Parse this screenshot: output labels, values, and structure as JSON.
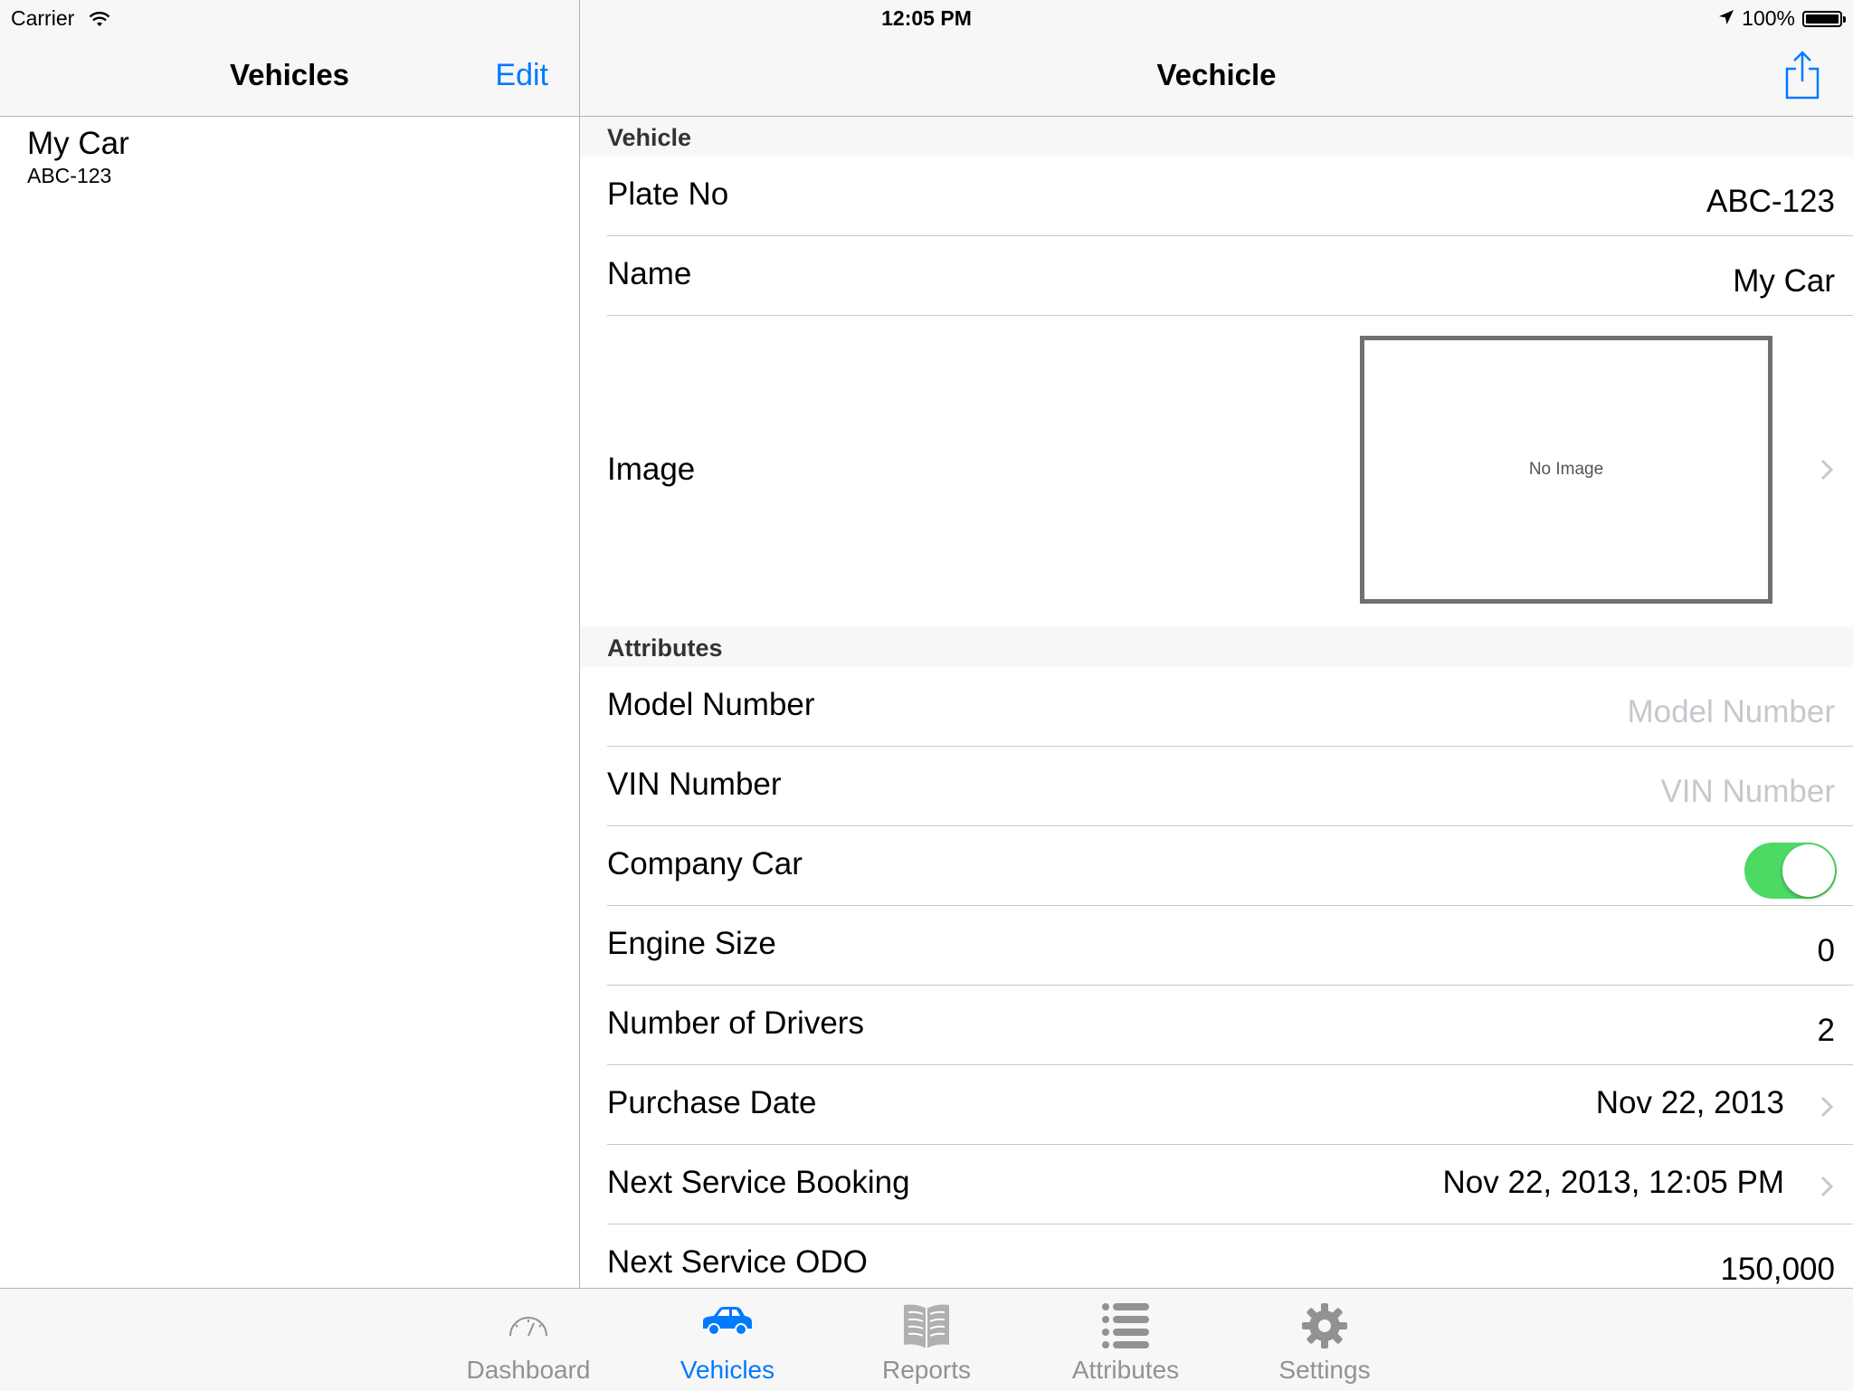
{
  "status_bar": {
    "carrier": "Carrier",
    "time": "12:05 PM",
    "battery": "100%"
  },
  "master": {
    "nav_title": "Vehicles",
    "edit_label": "Edit",
    "vehicles": [
      {
        "name": "My Car",
        "plate": "ABC-123"
      }
    ]
  },
  "detail": {
    "nav_title": "Vechicle",
    "sections": {
      "vehicle": {
        "header": "Vehicle",
        "plate": {
          "label": "Plate No",
          "value": "ABC-123"
        },
        "name": {
          "label": "Name",
          "value": "My Car"
        },
        "image": {
          "label": "Image",
          "placeholder": "No Image"
        }
      },
      "attributes": {
        "header": "Attributes",
        "model_number": {
          "label": "Model Number",
          "placeholder": "Model Number"
        },
        "vin_number": {
          "label": "VIN Number",
          "placeholder": "VIN Number"
        },
        "company_car": {
          "label": "Company Car",
          "on": true
        },
        "engine_size": {
          "label": "Engine Size",
          "value": "0"
        },
        "drivers": {
          "label": "Number of Drivers",
          "value": "2"
        },
        "purchase_date": {
          "label": "Purchase Date",
          "value": "Nov 22, 2013"
        },
        "next_service_booking": {
          "label": "Next Service Booking",
          "value": "Nov 22, 2013, 12:05 PM"
        },
        "next_service_odo": {
          "label": "Next Service ODO",
          "value": "150,000"
        }
      }
    }
  },
  "tabbar": {
    "tabs": [
      {
        "label": "Dashboard",
        "icon": "dashboard-icon"
      },
      {
        "label": "Vehicles",
        "icon": "car-icon"
      },
      {
        "label": "Reports",
        "icon": "book-icon"
      },
      {
        "label": "Attributes",
        "icon": "list-icon"
      },
      {
        "label": "Settings",
        "icon": "gear-icon"
      }
    ],
    "active_index": 1
  },
  "colors": {
    "accent": "#007aff",
    "toggle_on": "#4cd964",
    "inactive_tab": "#929292"
  }
}
